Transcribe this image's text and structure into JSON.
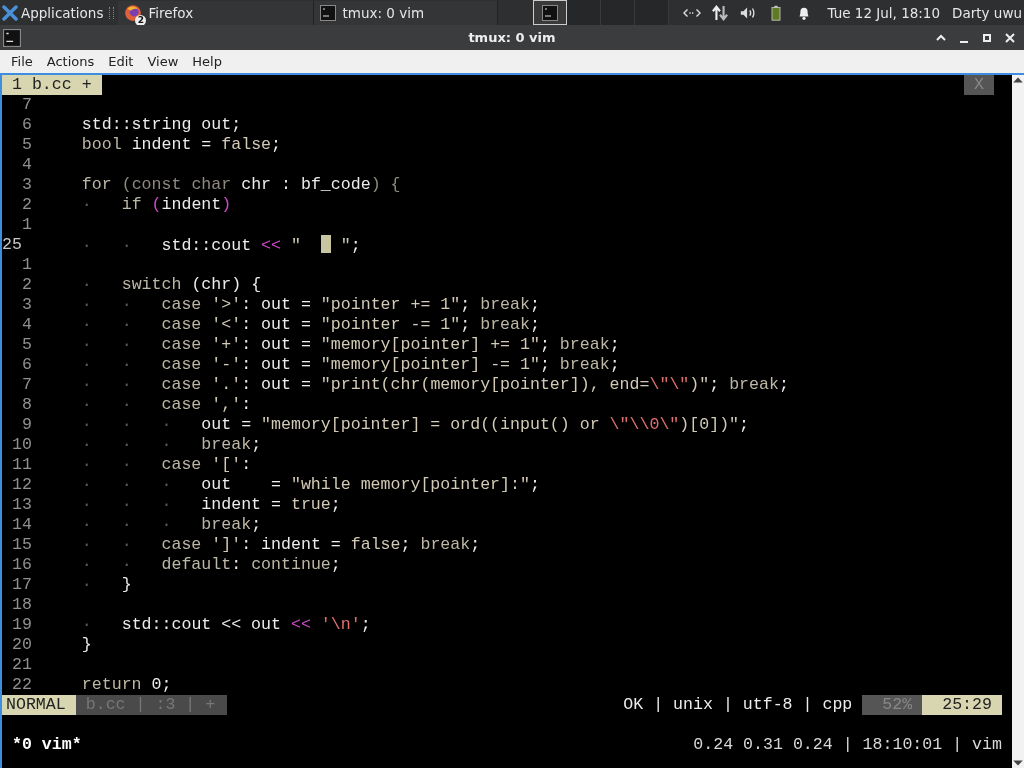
{
  "taskbar": {
    "applications": "Applications",
    "tasks": [
      {
        "label": "Firefox",
        "kind": "browser",
        "badge": "2",
        "selected": false
      },
      {
        "label": "tmux: 0 vim",
        "kind": "terminal",
        "selected": false
      }
    ],
    "workspaces": [
      {
        "selected": true,
        "kind": "terminal"
      },
      {
        "selected": false
      },
      {
        "selected": false
      },
      {
        "selected": false
      }
    ],
    "clock": "Tue 12 Jul, 18:10",
    "user": "Darty uwu"
  },
  "window": {
    "title": "tmux: 0 vim"
  },
  "menu": [
    "File",
    "Actions",
    "Edit",
    "View",
    "Help"
  ],
  "tabline": {
    "tabs": [
      {
        "label": "1 b.cc +",
        "selected": true
      }
    ],
    "close": "X"
  },
  "lines": [
    {
      "number": "7"
    },
    {
      "number": "6",
      "tokens": [
        {
          "text": "    std::string out;",
          "kind": "plain"
        }
      ]
    },
    {
      "number": "5",
      "tokens": [
        {
          "text": "    bool",
          "kind": "keyword"
        },
        {
          "text": " indent = ",
          "kind": "plain"
        },
        {
          "text": "false",
          "kind": "string"
        },
        {
          "text": ";",
          "kind": "plain"
        }
      ]
    },
    {
      "number": "4"
    },
    {
      "number": "3",
      "tokens": [
        {
          "text": "    for",
          "kind": "keyword"
        },
        {
          "text": " (const char",
          "kind": "type"
        },
        {
          "text": " chr : bf_code",
          "kind": "plain"
        },
        {
          "text": ") {",
          "kind": "type"
        }
      ]
    },
    {
      "number": "2",
      "tokens": [
        {
          "text": "    ·   ",
          "kind": "guide"
        },
        {
          "text": "if ",
          "kind": "keyword"
        },
        {
          "text": "(",
          "kind": "operator"
        },
        {
          "text": "indent",
          "kind": "plain"
        },
        {
          "text": ")",
          "kind": "operator"
        }
      ]
    },
    {
      "number": "1"
    },
    {
      "number": "25",
      "current": true,
      "tokens": [
        {
          "text": "    ·   ·   ",
          "kind": "guide"
        },
        {
          "text": "std::cout ",
          "kind": "plain"
        },
        {
          "text": "<<",
          "kind": "operator"
        },
        {
          "text": " \"  ",
          "kind": "string"
        },
        {
          "kind": "cursor"
        },
        {
          "text": " \"",
          "kind": "string"
        },
        {
          "text": ";",
          "kind": "plain"
        }
      ]
    },
    {
      "number": "1"
    },
    {
      "number": "2",
      "tokens": [
        {
          "text": "    ·   ",
          "kind": "guide"
        },
        {
          "text": "switch",
          "kind": "keyword"
        },
        {
          "text": " (chr) {",
          "kind": "plain"
        }
      ]
    },
    {
      "number": "3",
      "tokens": [
        {
          "text": "    ·   ·   ",
          "kind": "guide"
        },
        {
          "text": "case ",
          "kind": "keyword"
        },
        {
          "text": "'>'",
          "kind": "string"
        },
        {
          "text": ": out = ",
          "kind": "plain"
        },
        {
          "text": "\"pointer += 1\"",
          "kind": "string"
        },
        {
          "text": "; ",
          "kind": "plain"
        },
        {
          "text": "break",
          "kind": "keyword"
        },
        {
          "text": ";",
          "kind": "plain"
        }
      ]
    },
    {
      "number": "4",
      "tokens": [
        {
          "text": "    ·   ·   ",
          "kind": "guide"
        },
        {
          "text": "case ",
          "kind": "keyword"
        },
        {
          "text": "'<'",
          "kind": "string"
        },
        {
          "text": ": out = ",
          "kind": "plain"
        },
        {
          "text": "\"pointer -= 1\"",
          "kind": "string"
        },
        {
          "text": "; ",
          "kind": "plain"
        },
        {
          "text": "break",
          "kind": "keyword"
        },
        {
          "text": ";",
          "kind": "plain"
        }
      ]
    },
    {
      "number": "5",
      "tokens": [
        {
          "text": "    ·   ·   ",
          "kind": "guide"
        },
        {
          "text": "case ",
          "kind": "keyword"
        },
        {
          "text": "'+'",
          "kind": "string"
        },
        {
          "text": ": out = ",
          "kind": "plain"
        },
        {
          "text": "\"memory[pointer] += 1\"",
          "kind": "string"
        },
        {
          "text": "; ",
          "kind": "plain"
        },
        {
          "text": "break",
          "kind": "keyword"
        },
        {
          "text": ";",
          "kind": "plain"
        }
      ]
    },
    {
      "number": "6",
      "tokens": [
        {
          "text": "    ·   ·   ",
          "kind": "guide"
        },
        {
          "text": "case ",
          "kind": "keyword"
        },
        {
          "text": "'-'",
          "kind": "string"
        },
        {
          "text": ": out = ",
          "kind": "plain"
        },
        {
          "text": "\"memory[pointer] -= 1\"",
          "kind": "string"
        },
        {
          "text": "; ",
          "kind": "plain"
        },
        {
          "text": "break",
          "kind": "keyword"
        },
        {
          "text": ";",
          "kind": "plain"
        }
      ]
    },
    {
      "number": "7",
      "tokens": [
        {
          "text": "    ·   ·   ",
          "kind": "guide"
        },
        {
          "text": "case ",
          "kind": "keyword"
        },
        {
          "text": "'.'",
          "kind": "string"
        },
        {
          "text": ": out = ",
          "kind": "plain"
        },
        {
          "text": "\"print(chr(memory[pointer]), end=",
          "kind": "string"
        },
        {
          "text": "\\\"\\\"",
          "kind": "escape"
        },
        {
          "text": ")\"",
          "kind": "string"
        },
        {
          "text": "; ",
          "kind": "plain"
        },
        {
          "text": "break",
          "kind": "keyword"
        },
        {
          "text": ";",
          "kind": "plain"
        }
      ]
    },
    {
      "number": "8",
      "tokens": [
        {
          "text": "    ·   ·   ",
          "kind": "guide"
        },
        {
          "text": "case ",
          "kind": "keyword"
        },
        {
          "text": "','",
          "kind": "string"
        },
        {
          "text": ":",
          "kind": "plain"
        }
      ]
    },
    {
      "number": "9",
      "tokens": [
        {
          "text": "    ·   ·   ·   ",
          "kind": "guide"
        },
        {
          "text": "out = ",
          "kind": "plain"
        },
        {
          "text": "\"memory[pointer] = ord((input() or ",
          "kind": "string"
        },
        {
          "text": "\\\"\\\\0\\\"",
          "kind": "escape"
        },
        {
          "text": ")[0])\"",
          "kind": "string"
        },
        {
          "text": ";",
          "kind": "plain"
        }
      ]
    },
    {
      "number": "10",
      "tokens": [
        {
          "text": "    ·   ·   ·   ",
          "kind": "guide"
        },
        {
          "text": "break",
          "kind": "keyword"
        },
        {
          "text": ";",
          "kind": "plain"
        }
      ]
    },
    {
      "number": "11",
      "tokens": [
        {
          "text": "    ·   ·   ",
          "kind": "guide"
        },
        {
          "text": "case ",
          "kind": "keyword"
        },
        {
          "text": "'['",
          "kind": "string"
        },
        {
          "text": ":",
          "kind": "plain"
        }
      ]
    },
    {
      "number": "12",
      "tokens": [
        {
          "text": "    ·   ·   ·   ",
          "kind": "guide"
        },
        {
          "text": "out    = ",
          "kind": "plain"
        },
        {
          "text": "\"while memory[pointer]:\"",
          "kind": "string"
        },
        {
          "text": ";",
          "kind": "plain"
        }
      ]
    },
    {
      "number": "13",
      "tokens": [
        {
          "text": "    ·   ·   ·   ",
          "kind": "guide"
        },
        {
          "text": "indent = ",
          "kind": "plain"
        },
        {
          "text": "true",
          "kind": "string"
        },
        {
          "text": ";",
          "kind": "plain"
        }
      ]
    },
    {
      "number": "14",
      "tokens": [
        {
          "text": "    ·   ·   ·   ",
          "kind": "guide"
        },
        {
          "text": "break",
          "kind": "keyword"
        },
        {
          "text": ";",
          "kind": "plain"
        }
      ]
    },
    {
      "number": "15",
      "tokens": [
        {
          "text": "    ·   ·   ",
          "kind": "guide"
        },
        {
          "text": "case ",
          "kind": "keyword"
        },
        {
          "text": "']'",
          "kind": "string"
        },
        {
          "text": ": indent = ",
          "kind": "plain"
        },
        {
          "text": "false",
          "kind": "string"
        },
        {
          "text": "; ",
          "kind": "plain"
        },
        {
          "text": "break",
          "kind": "keyword"
        },
        {
          "text": ";",
          "kind": "plain"
        }
      ]
    },
    {
      "number": "16",
      "tokens": [
        {
          "text": "    ·   ·   ",
          "kind": "guide"
        },
        {
          "text": "default",
          "kind": "keyword"
        },
        {
          "text": ": ",
          "kind": "plain"
        },
        {
          "text": "continue",
          "kind": "keyword"
        },
        {
          "text": ";",
          "kind": "plain"
        }
      ]
    },
    {
      "number": "17",
      "tokens": [
        {
          "text": "    ·   ",
          "kind": "guide"
        },
        {
          "text": "}",
          "kind": "plain"
        }
      ]
    },
    {
      "number": "18"
    },
    {
      "number": "19",
      "tokens": [
        {
          "text": "    ·   ",
          "kind": "guide"
        },
        {
          "text": "std::cout << out ",
          "kind": "plain"
        },
        {
          "text": "<<",
          "kind": "operator"
        },
        {
          "text": " '\\n'",
          "kind": "escape"
        },
        {
          "text": ";",
          "kind": "plain"
        }
      ]
    },
    {
      "number": "20",
      "tokens": [
        {
          "text": "    }",
          "kind": "plain"
        }
      ]
    },
    {
      "number": "21"
    },
    {
      "number": "22",
      "tokens": [
        {
          "text": "    return",
          "kind": "keyword"
        },
        {
          "text": " 0;",
          "kind": "plain"
        }
      ]
    }
  ],
  "statusline": {
    "mode": "NORMAL",
    "file_info": "b.cc | :3 | +",
    "info": "OK | unix | utf-8 | cpp",
    "percent": "52%",
    "position": "25:29"
  },
  "tmux": {
    "window": "*0 vim*",
    "status": "0.24 0.31 0.24 | 18:10:01 | vim"
  }
}
